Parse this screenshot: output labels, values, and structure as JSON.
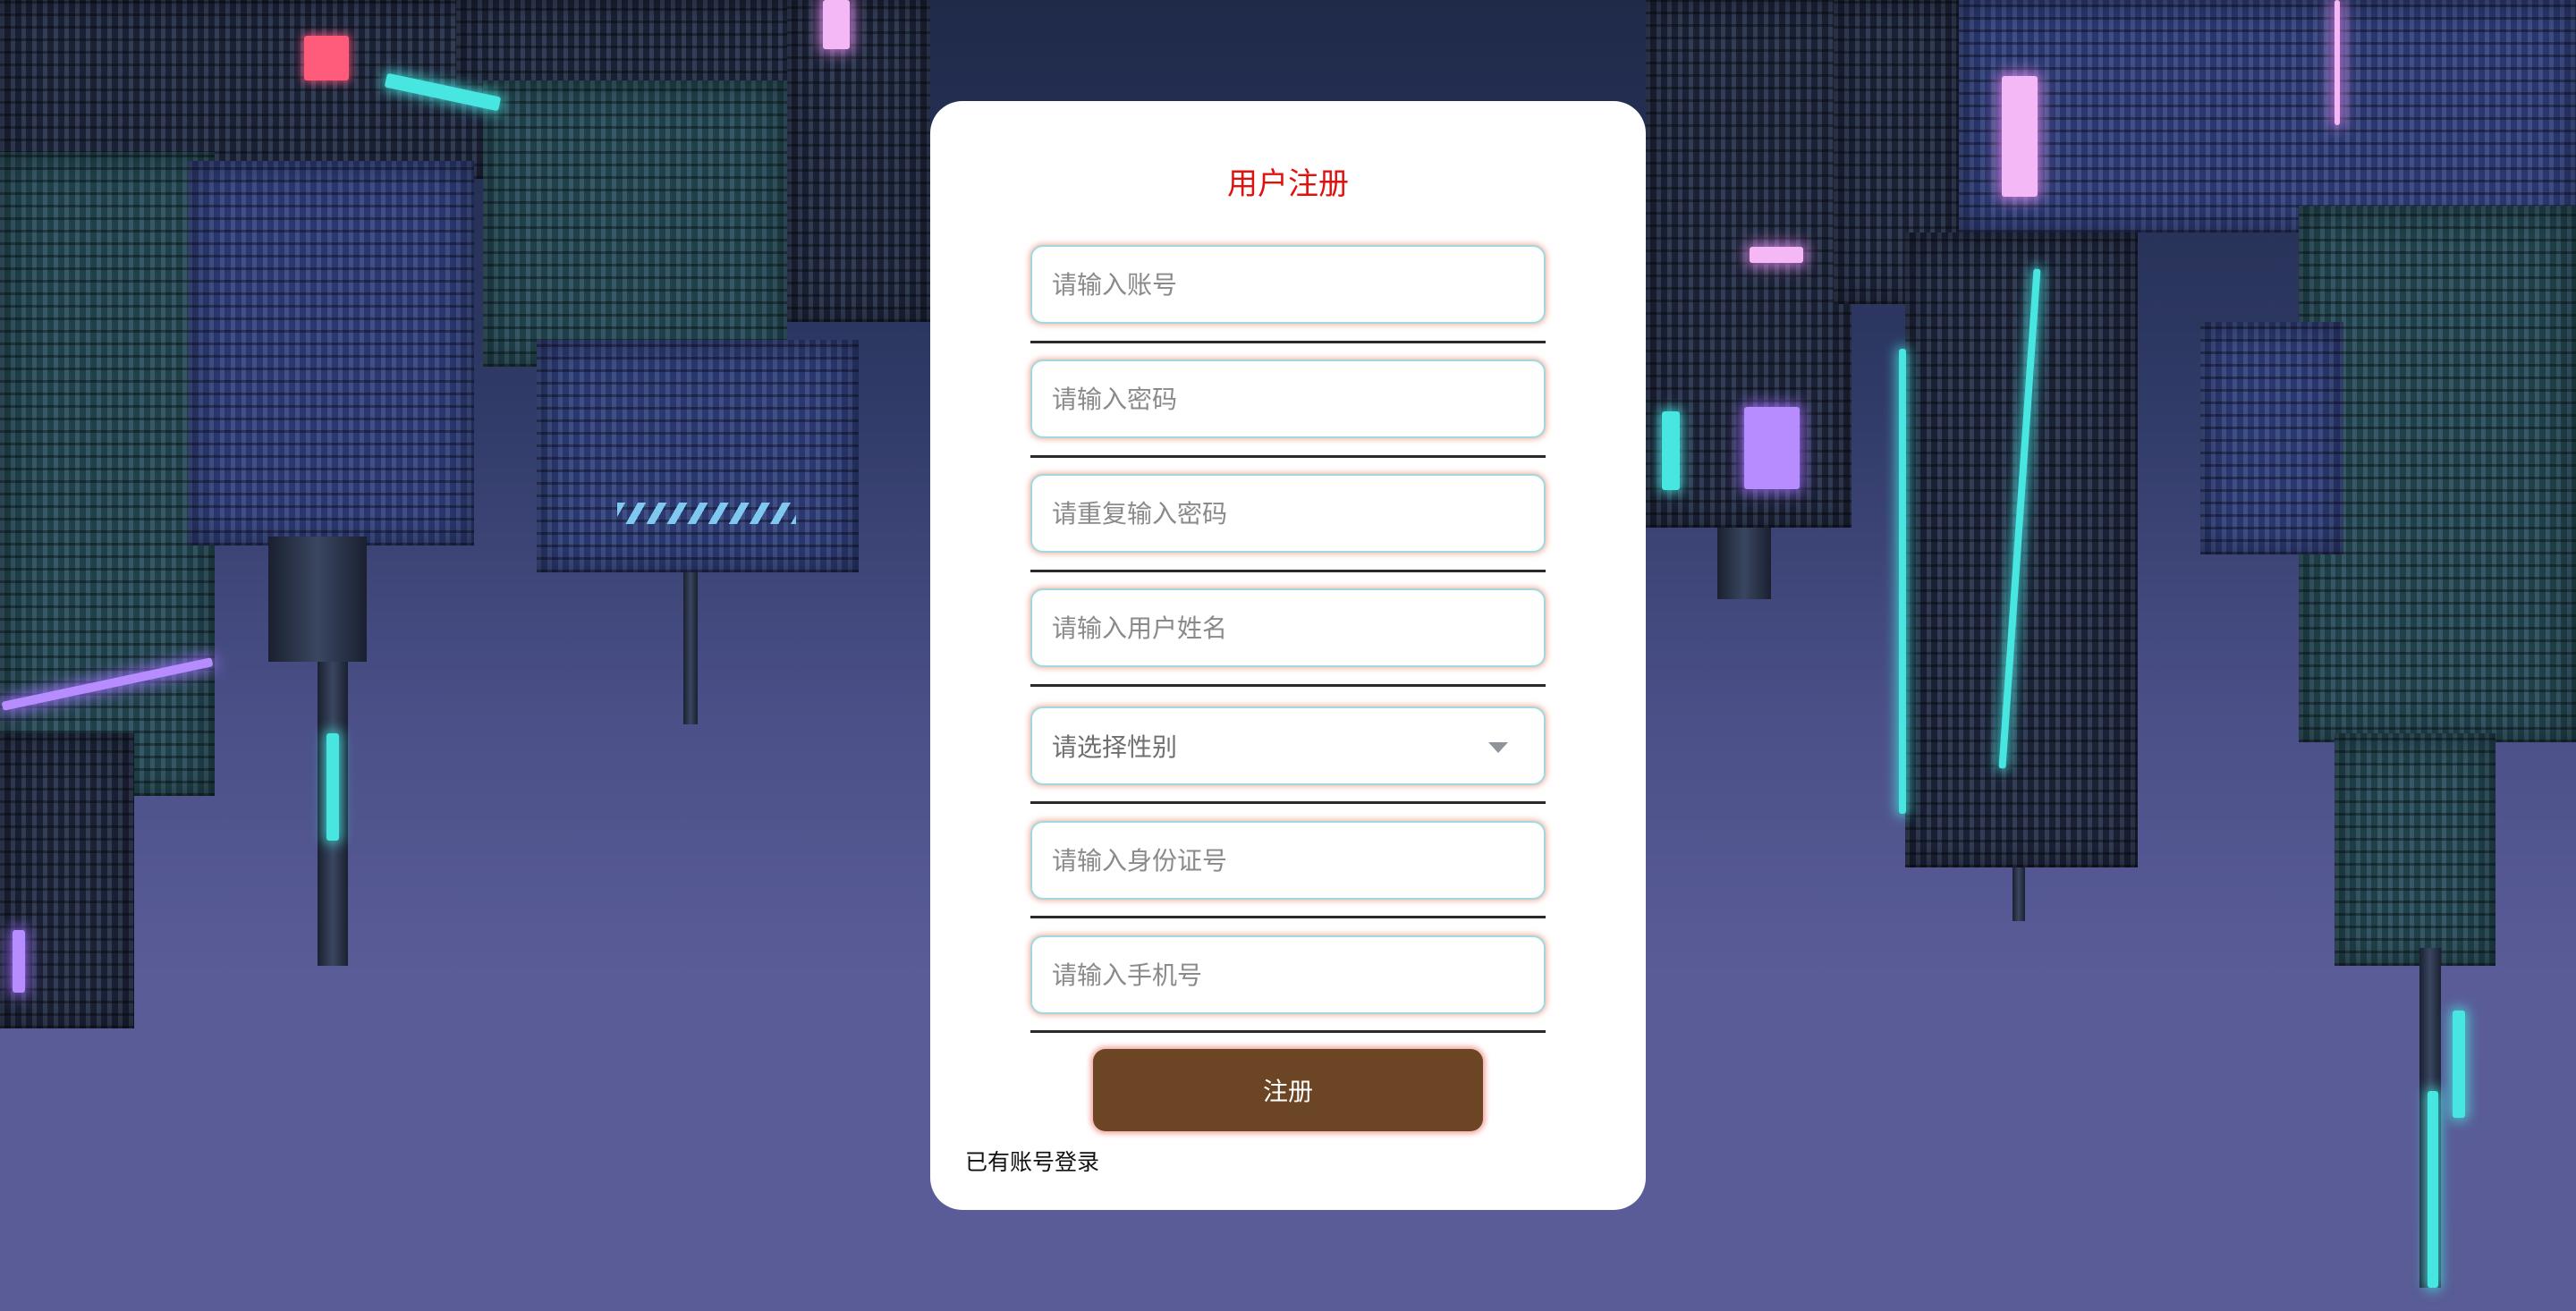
{
  "page": {
    "title": "用户注册"
  },
  "form": {
    "account": {
      "placeholder": "请输入账号",
      "value": ""
    },
    "password": {
      "placeholder": "请输入密码",
      "value": ""
    },
    "password_repeat": {
      "placeholder": "请重复输入密码",
      "value": ""
    },
    "user_name": {
      "placeholder": "请输入用户姓名",
      "value": ""
    },
    "gender": {
      "placeholder": "请选择性别",
      "selected": ""
    },
    "id_number": {
      "placeholder": "请输入身份证号",
      "value": ""
    },
    "phone": {
      "placeholder": "请输入手机号",
      "value": ""
    },
    "submit_label": "注册",
    "login_link": "已有账号登录"
  },
  "icons": {
    "gender_dropdown": "chevron-down-icon"
  },
  "colors": {
    "title": "#e0120f",
    "button": "#6b4524",
    "field_border": "#9fd9df",
    "field_glow": "#f0aa96"
  }
}
